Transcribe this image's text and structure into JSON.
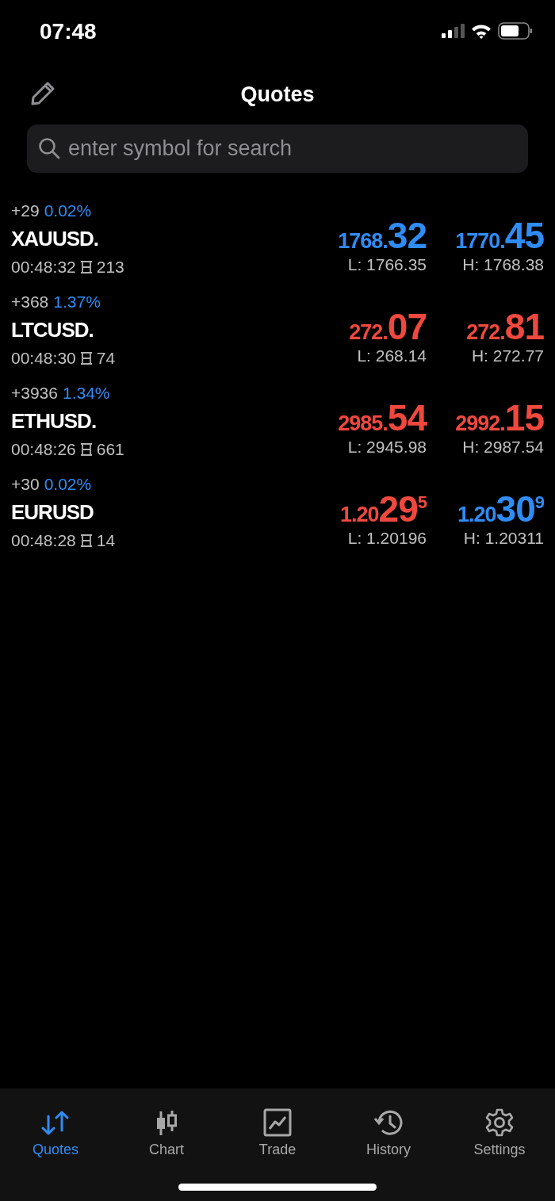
{
  "status_bar": {
    "time": "07:48"
  },
  "header": {
    "title": "Quotes"
  },
  "search": {
    "placeholder": "enter symbol for search"
  },
  "quotes": [
    {
      "change": "+29",
      "percent": "0.02%",
      "symbol": "XAUUSD.",
      "time": "00:48:32",
      "spread": "213",
      "bid": {
        "head": "1768.",
        "digits": "32",
        "color": "#2f8cf5"
      },
      "low": "L: 1766.35",
      "ask": {
        "head": "1770.",
        "digits": "45",
        "color": "#2f8cf5"
      },
      "high": "H: 1768.38"
    },
    {
      "change": "+368",
      "percent": "1.37%",
      "symbol": "LTCUSD.",
      "time": "00:48:30",
      "spread": "74",
      "bid": {
        "head": "272.",
        "digits": "07",
        "color": "#f0483e"
      },
      "low": "L: 268.14",
      "ask": {
        "head": "272.",
        "digits": "81",
        "color": "#f0483e"
      },
      "high": "H: 272.77"
    },
    {
      "change": "+3936",
      "percent": "1.34%",
      "symbol": "ETHUSD.",
      "time": "00:48:26",
      "spread": "661",
      "bid": {
        "head": "2985.",
        "digits": "54",
        "color": "#f0483e"
      },
      "low": "L: 2945.98",
      "ask": {
        "head": "2992.",
        "digits": "15",
        "color": "#f0483e"
      },
      "high": "H: 2987.54"
    },
    {
      "change": "+30",
      "percent": "0.02%",
      "symbol": "EURUSD",
      "time": "00:48:28",
      "spread": "14",
      "bid": {
        "head": "1.20",
        "digits": "29",
        "sup": "5",
        "color": "#f0483e"
      },
      "low": "L: 1.20196",
      "ask": {
        "head": "1.20",
        "digits": "30",
        "sup": "9",
        "color": "#2f8cf5"
      },
      "high": "H: 1.20311"
    }
  ],
  "tabs": [
    {
      "label": "Quotes",
      "kind": "quotes",
      "selected": true
    },
    {
      "label": "Chart",
      "kind": "chart",
      "selected": false
    },
    {
      "label": "Trade",
      "kind": "trade",
      "selected": false
    },
    {
      "label": "History",
      "kind": "history",
      "selected": false
    },
    {
      "label": "Settings",
      "kind": "settings",
      "selected": false
    }
  ]
}
